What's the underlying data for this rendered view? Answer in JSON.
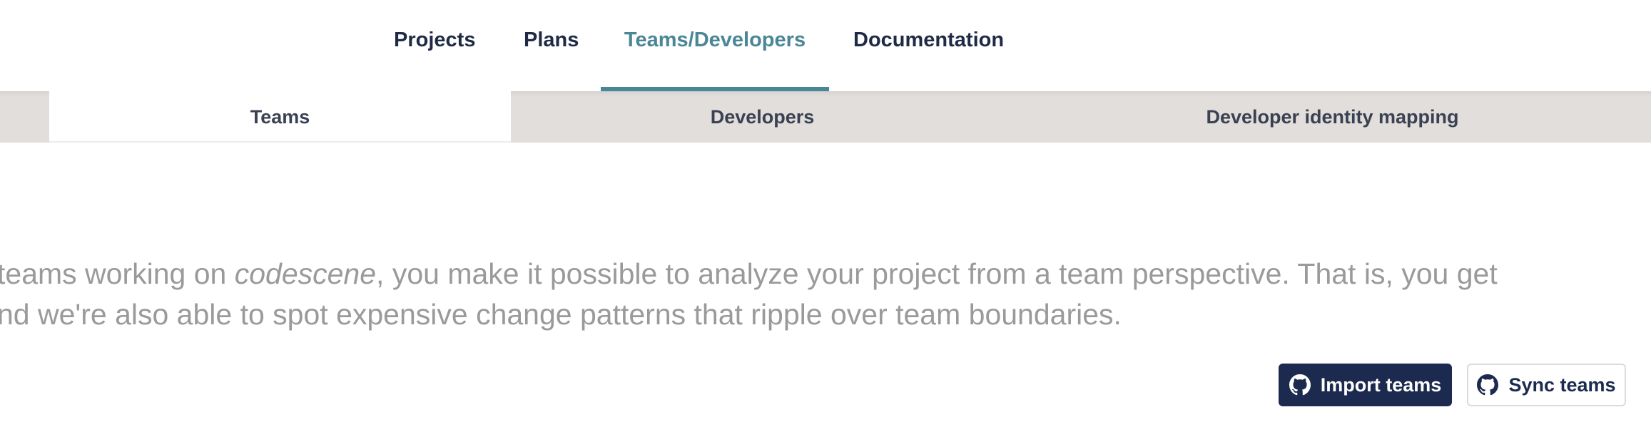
{
  "top_nav": {
    "tabs": [
      {
        "label": "Projects"
      },
      {
        "label": "Plans"
      },
      {
        "label": "Teams/Developers"
      },
      {
        "label": "Documentation"
      }
    ],
    "active_tab": "Teams/Developers"
  },
  "sub_nav": {
    "tabs": [
      {
        "label": "Teams"
      },
      {
        "label": "Developers"
      },
      {
        "label": "Developer identity mapping"
      }
    ],
    "active_tab": "Teams"
  },
  "description": {
    "line1_before": "teams working on ",
    "line1_italic": "codescene",
    "line1_after": ", you make it possible to analyze your project from a team perspective. That is, you get",
    "line2": "nd we're also able to spot expensive change patterns that ripple over team boundaries."
  },
  "actions": {
    "import_label": "Import teams",
    "sync_label": "Sync teams",
    "icon": "github-icon"
  },
  "colors": {
    "accent": "#4a8796",
    "primary_button": "#1b2a4e",
    "nav_text": "#1f2a44",
    "sub_bar_bg": "#e1dedb",
    "description_text": "#9a9a9a"
  }
}
